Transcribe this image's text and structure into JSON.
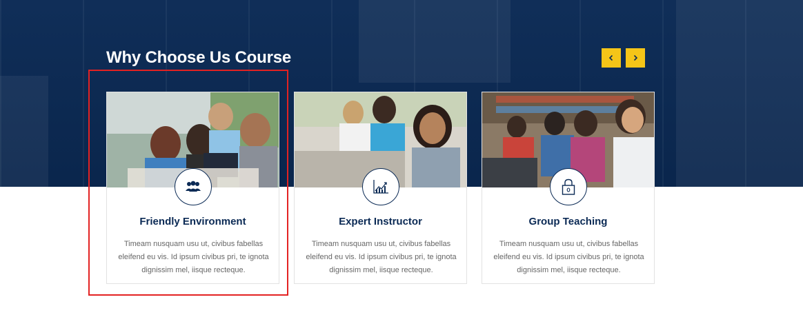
{
  "section": {
    "title": "Why Choose Us Course"
  },
  "carousel": {
    "prev_icon": "chevron-left-icon",
    "next_icon": "chevron-right-icon",
    "button_color": "#f5c518"
  },
  "cards": [
    {
      "title": "Friendly Environment",
      "description": "Timeam nusquam usu ut, civibus fabellas eleifend eu vis. Id ipsum civibus pri, te ignota dignissim mel, iisque recteque.",
      "icon": "group-people-icon"
    },
    {
      "title": "Expert Instructor",
      "description": "Timeam nusquam usu ut, civibus fabellas eleifend eu vis. Id ipsum civibus pri, te ignota dignissim mel, iisque recteque.",
      "icon": "growth-chart-icon"
    },
    {
      "title": "Group Teaching",
      "description": "Timeam nusquam usu ut, civibus fabellas eleifend eu vis. Id ipsum civibus pri, te ignota dignissim mel, iisque recteque.",
      "icon": "padlock-icon"
    }
  ],
  "colors": {
    "navy": "#0b2a55",
    "highlight_border": "#e32222"
  }
}
